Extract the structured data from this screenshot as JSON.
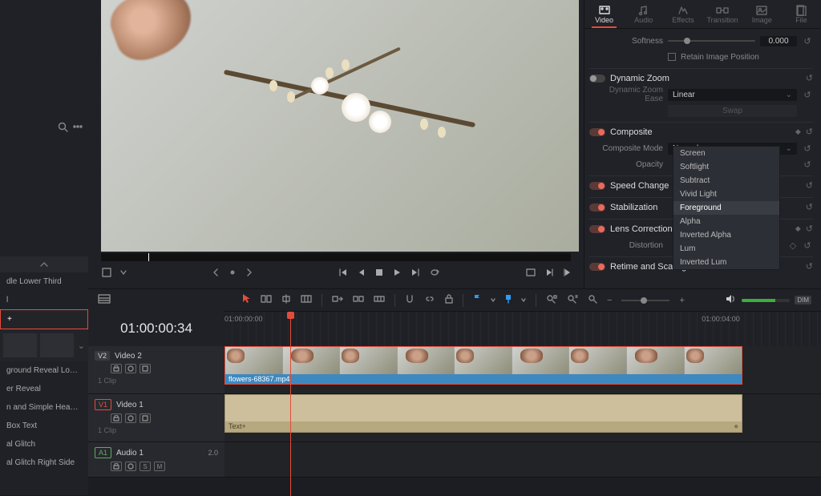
{
  "sidebar": {
    "items": [
      {
        "label": "dle Lower Third"
      },
      {
        "label": "l"
      },
      {
        "label": "+"
      },
      {
        "label": "ground Reveal Low…"
      },
      {
        "label": "er Reveal"
      },
      {
        "label": "n and Simple Headi…"
      },
      {
        "label": "Box Text"
      },
      {
        "label": "al Glitch"
      },
      {
        "label": "al Glitch Right Side"
      }
    ],
    "selected_index": 2
  },
  "timecode": "01:00:00:34",
  "ruler": {
    "labels": [
      {
        "text": "01:00:00:00",
        "leftPct": 0
      },
      {
        "text": "01:00:04:00",
        "leftPct": 80
      }
    ],
    "playhead_pct": 11
  },
  "tracks": {
    "v2": {
      "tag": "V2",
      "name": "Video 2",
      "sub": "1 Clip",
      "clip_label": "flowers-68367.mp4"
    },
    "v1": {
      "tag": "V1",
      "name": "Video 1",
      "sub": "1 Clip",
      "clip_label": "Text+",
      "fx": "⋄"
    },
    "a1": {
      "tag": "A1",
      "name": "Audio 1",
      "level": "2.0"
    }
  },
  "toolbar": {
    "dim": "DIM"
  },
  "inspector": {
    "tabs": [
      "Video",
      "Audio",
      "Effects",
      "Transition",
      "Image",
      "File"
    ],
    "active_tab": 0,
    "softness": {
      "label": "Softness",
      "value": "0.000",
      "slider_pct": 18
    },
    "retain": {
      "label": "Retain Image Position"
    },
    "sections": {
      "dynamic_zoom": {
        "label": "Dynamic Zoom",
        "on": false
      },
      "dz_ease": {
        "label": "Dynamic Zoom Ease",
        "value": "Linear"
      },
      "swap": {
        "label": "Swap"
      },
      "composite": {
        "label": "Composite",
        "on": true
      },
      "composite_mode": {
        "label": "Composite Mode",
        "value": "Normal"
      },
      "opacity": {
        "label": "Opacity"
      },
      "speed": {
        "label": "Speed Change",
        "on": true
      },
      "stabilization": {
        "label": "Stabilization",
        "on": true
      },
      "lens": {
        "label": "Lens Correction",
        "on": true
      },
      "distortion": {
        "label": "Distortion"
      },
      "retime": {
        "label": "Retime and Scaling",
        "on": true
      }
    },
    "dropdown_items": [
      "Screen",
      "Softlight",
      "Subtract",
      "Vivid Light",
      "Foreground",
      "Alpha",
      "Inverted Alpha",
      "Lum",
      "Inverted Lum"
    ],
    "dropdown_selected": 4
  }
}
